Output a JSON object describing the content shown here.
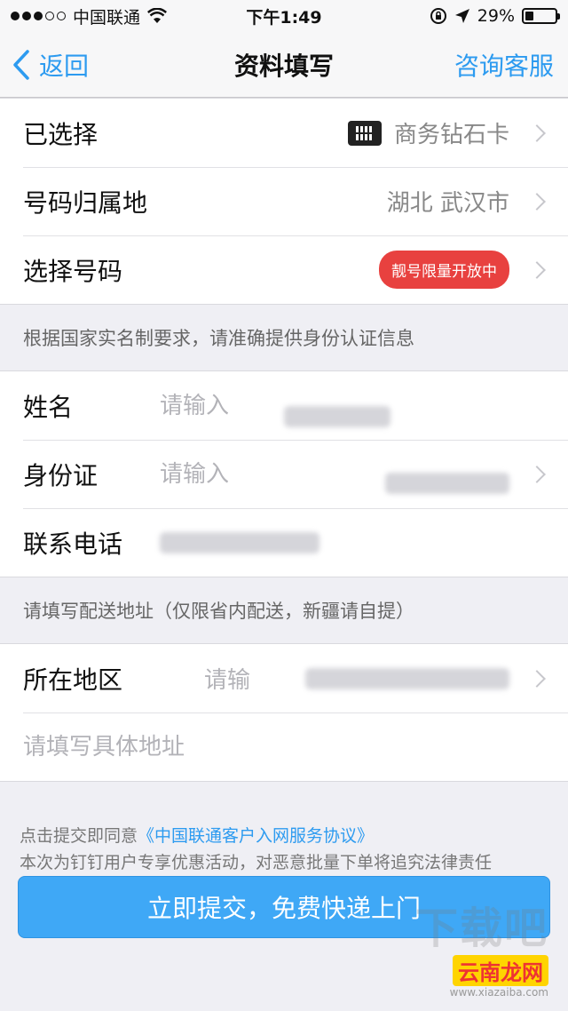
{
  "status": {
    "carrier": "中国联通",
    "time": "下午1:49",
    "battery": "29%",
    "battery_level": 0.29
  },
  "nav": {
    "back_label": "返回",
    "title": "资料填写",
    "service_label": "咨询客服"
  },
  "plan": {
    "selected_label": "已选择",
    "selected_value": "商务钻石卡",
    "region_label": "号码归属地",
    "region_value": "湖北 武汉市",
    "number_label": "选择号码",
    "number_badge": "靓号限量开放中"
  },
  "identity": {
    "note": "根据国家实名制要求，请准确提供身份认证信息",
    "name_label": "姓名",
    "name_placeholder": "请输入",
    "id_label": "身份证",
    "id_placeholder": "请输入",
    "phone_label": "联系电话"
  },
  "address": {
    "note": "请填写配送地址（仅限省内配送，新疆请自提）",
    "area_label": "所在地区",
    "area_placeholder": "请输",
    "detail_placeholder": "请填写具体地址"
  },
  "footer": {
    "agree_prefix": "点击提交即同意",
    "agree_link": "《中国联通客户入网服务协议》",
    "notice": "本次为钉钉用户专享优惠活动，对恶意批量下单将追究法律责任",
    "submit_label": "立即提交，免费快递上门"
  },
  "watermark": {
    "top": "下载吧",
    "logo": "云南龙网",
    "url": "www.xiazaiba.com"
  }
}
